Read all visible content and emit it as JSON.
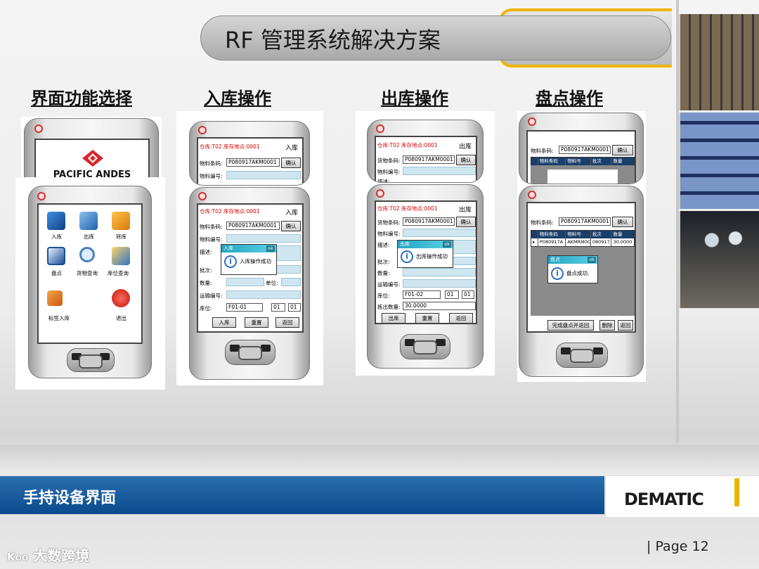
{
  "title": "RF 管理系统解决方案",
  "sections": {
    "s1": "界面功能选择",
    "s2": "入库操作",
    "s3": "出库操作",
    "s4": "盘点操作"
  },
  "banner": "手持设备界面",
  "logo": "DEMATIC",
  "page": "|   Page   12",
  "watermark": "大数跨境",
  "colors": {
    "accent": "#f0b400",
    "banner": "#0b4a8e",
    "header_red": "#cc0000",
    "dialog_header": "#21a6c2"
  },
  "menu": {
    "splash_brand": "PACIFIC ANDES",
    "items": [
      {
        "label": "入库",
        "icon": "inbound-icon"
      },
      {
        "label": "出库",
        "icon": "outbound-icon"
      },
      {
        "label": "转库",
        "icon": "transfer-icon"
      },
      {
        "label": "盘点",
        "icon": "inventory-count-icon"
      },
      {
        "label": "货物查询",
        "icon": "goods-search-icon"
      },
      {
        "label": "库位查询",
        "icon": "location-search-icon"
      },
      {
        "label": "标签入库",
        "icon": "label-inbound-icon"
      },
      {
        "label": "退出",
        "icon": "power-icon"
      }
    ]
  },
  "inbound": {
    "header_left": "仓库:T02   库存地点:0001",
    "title": "入库",
    "barcode_label": "物料条码:",
    "barcode_value": "P080917AKM0001",
    "confirm": "确认",
    "material_label": "物料编号:",
    "desc_label": "描述:",
    "batch_label": "批次:",
    "qty_label": "数量:",
    "unit_label": "单位:",
    "transport_label": "运输编号:",
    "location_label": "库位:",
    "location_value": "F01-01",
    "loc2": "01",
    "loc3": "01",
    "btn_in": "入库",
    "btn_reset": "重置",
    "btn_back": "返回",
    "dialog_title": "入库",
    "dialog_ok": "ok",
    "dialog_msg": "入库操作成功"
  },
  "outbound": {
    "header_left": "仓库:T02   库存地点:0001",
    "title": "出库",
    "barcode_label": "货物条码:",
    "barcode_value": "P080917AKM0001",
    "confirm": "确认",
    "material_label": "物料编号:",
    "desc_label": "描述:",
    "batch_label": "批次:",
    "qty_label": "数量:",
    "transport_label": "运输编号:",
    "location_label": "库位:",
    "location_value": "F01-02",
    "loc2": "01",
    "loc3": "01",
    "out_qty_label": "拣出数量:",
    "out_qty_value": "30.0000",
    "btn_out": "出库",
    "btn_reset": "重置",
    "btn_back": "返回",
    "dialog_title": "出库",
    "dialog_ok": "ok",
    "dialog_msg": "出库操作成功"
  },
  "count": {
    "barcode_label": "物料条码:",
    "barcode_value": "P080917AKM0001",
    "confirm": "确认",
    "columns": [
      "物料条码",
      "物料号",
      "批次",
      "数量"
    ],
    "row": {
      "barcode": "P080917A",
      "material": "AKMRM0C",
      "batch": "080917",
      "qty": "30.0000"
    },
    "dialog_title": "盘点",
    "dialog_ok": "ok",
    "dialog_msg": "盘点成功.",
    "btn_finish": "完成盘点并返回",
    "btn_delete": "删除",
    "btn_back": "返回"
  }
}
